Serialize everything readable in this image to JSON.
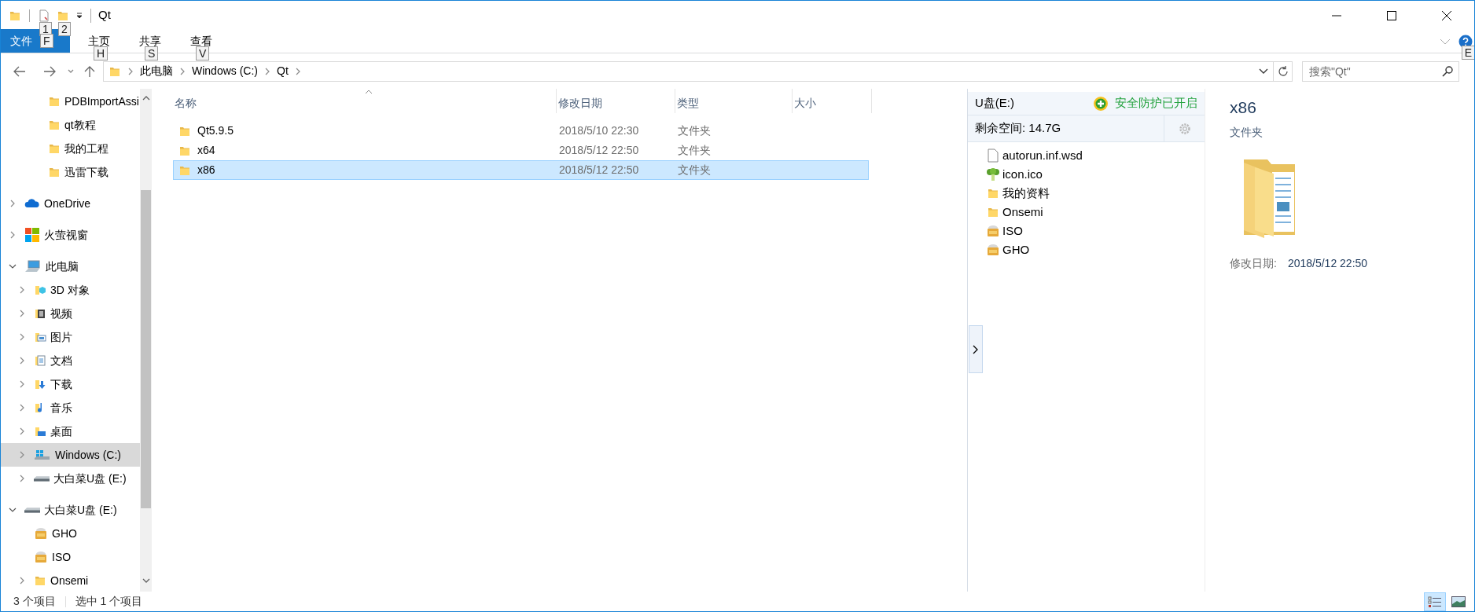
{
  "window": {
    "title": "Qt",
    "buttons": [
      {
        "kind": "minimize"
      },
      {
        "kind": "maximize"
      },
      {
        "kind": "close"
      }
    ]
  },
  "quick_access_toolbar": {
    "keytips": [
      "1",
      "2"
    ]
  },
  "ribbon": {
    "tabs": [
      {
        "label": "文件",
        "kind": "file",
        "keytip": "F",
        "selected": false
      },
      {
        "label": "主页",
        "kind": "tab",
        "keytip": "H",
        "selected": false
      },
      {
        "label": "共享",
        "kind": "tab",
        "keytip": "S",
        "selected": false
      },
      {
        "label": "查看",
        "kind": "tab",
        "keytip": "V",
        "selected": false
      }
    ],
    "help_keytip": "E"
  },
  "address_bar": {
    "segments": [
      "此电脑",
      "Windows (C:)",
      "Qt"
    ]
  },
  "search": {
    "placeholder": "搜索\"Qt\""
  },
  "navigation": {
    "quick_access_items": [
      {
        "label": "PDBImportAssi",
        "kind": "folder",
        "selected": false
      },
      {
        "label": "qt教程",
        "kind": "folder",
        "selected": false
      },
      {
        "label": "我的工程",
        "kind": "folder",
        "selected": false
      },
      {
        "label": "迅雷下载",
        "kind": "folder",
        "selected": false
      }
    ],
    "items": [
      {
        "label": "OneDrive",
        "kind": "onedrive",
        "expanded": false,
        "selected": false
      },
      {
        "label": "火萤视窗",
        "kind": "app",
        "expanded": false,
        "selected": false
      },
      {
        "label": "此电脑",
        "kind": "pc",
        "expanded": true,
        "selected": false,
        "children": [
          {
            "label": "3D 对象",
            "kind": "objects3d",
            "expanded": false,
            "selected": false
          },
          {
            "label": "视频",
            "kind": "video",
            "expanded": false,
            "selected": false
          },
          {
            "label": "图片",
            "kind": "pictures",
            "expanded": false,
            "selected": false
          },
          {
            "label": "文档",
            "kind": "documents",
            "expanded": false,
            "selected": false
          },
          {
            "label": "下载",
            "kind": "downloads",
            "expanded": false,
            "selected": false
          },
          {
            "label": "音乐",
            "kind": "music",
            "expanded": false,
            "selected": false
          },
          {
            "label": "桌面",
            "kind": "desktop",
            "expanded": false,
            "selected": false
          },
          {
            "label": "Windows (C:)",
            "kind": "windrive",
            "expanded": false,
            "selected": true
          },
          {
            "label": "大白菜U盘 (E:)",
            "kind": "usb",
            "expanded": false,
            "selected": false
          }
        ]
      },
      {
        "label": "大白菜U盘 (E:)",
        "kind": "usb",
        "expanded": true,
        "selected": false,
        "children": [
          {
            "label": "GHO",
            "kind": "gho",
            "selected": false
          },
          {
            "label": "ISO",
            "kind": "iso",
            "selected": false
          },
          {
            "label": "Onsemi",
            "kind": "folder",
            "expanded": false,
            "selected": false
          }
        ]
      }
    ]
  },
  "file_list": {
    "columns": [
      {
        "label": "名称",
        "sorted": true
      },
      {
        "label": "修改日期",
        "sorted": false
      },
      {
        "label": "类型",
        "sorted": false
      },
      {
        "label": "大小",
        "sorted": false
      }
    ],
    "rows": [
      {
        "name": "Qt5.9.5",
        "modified": "2018/5/10 22:30",
        "type": "文件夹",
        "selected": false
      },
      {
        "name": "x64",
        "modified": "2018/5/12 22:50",
        "type": "文件夹",
        "selected": false
      },
      {
        "name": "x86",
        "modified": "2018/5/12 22:50",
        "type": "文件夹",
        "selected": true
      }
    ]
  },
  "usb_panel": {
    "title": "U盘(E:)",
    "protection": "安全防护已开启",
    "free_space": "剩余空间: 14.7G",
    "items": [
      {
        "label": "autorun.inf.wsd",
        "kind": "file"
      },
      {
        "label": "icon.ico",
        "kind": "ico"
      },
      {
        "label": "我的资料",
        "kind": "folder"
      },
      {
        "label": "Onsemi",
        "kind": "folder"
      },
      {
        "label": "ISO",
        "kind": "iso"
      },
      {
        "label": "GHO",
        "kind": "gho"
      }
    ]
  },
  "details_pane": {
    "name": "x86",
    "type": "文件夹",
    "modified_label": "修改日期:",
    "modified_value": "2018/5/12 22:50"
  },
  "status_bar": {
    "item_count": "3 个项目",
    "selection": "选中 1 个项目",
    "views": [
      {
        "kind": "details",
        "selected": true
      },
      {
        "kind": "large_icons",
        "selected": false
      }
    ]
  }
}
